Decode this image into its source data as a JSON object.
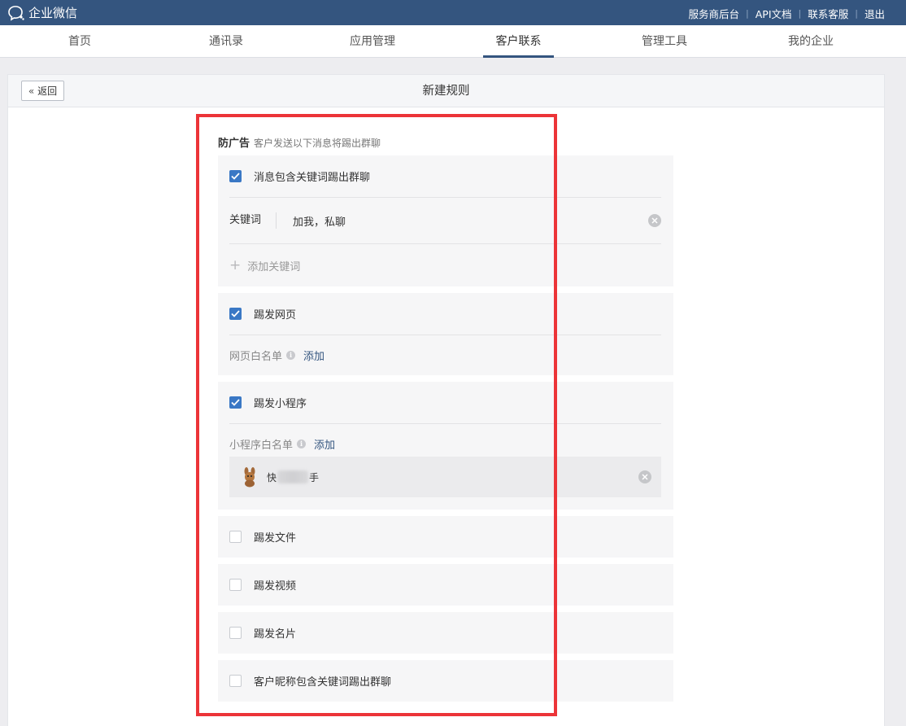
{
  "app": {
    "name": "企业微信"
  },
  "toplinks": [
    "服务商后台",
    "API文档",
    "联系客服",
    "退出"
  ],
  "nav": [
    "首页",
    "通讯录",
    "应用管理",
    "客户联系",
    "管理工具",
    "我的企业"
  ],
  "page": {
    "back_label": "返回",
    "title": "新建规则"
  },
  "section": {
    "title": "防广告",
    "subtitle": "客户发送以下消息将踢出群聊"
  },
  "keyword_block": {
    "checkbox_label": "消息包含关键词踢出群聊",
    "checked": true,
    "keyword_label": "关键词",
    "keyword_value": "加我，私聊",
    "add_keyword_label": "添加关键词"
  },
  "webpage_block": {
    "checkbox_label": "踢发网页",
    "checked": true,
    "whitelist_label": "网页白名单",
    "add_label": "添加"
  },
  "miniprogram_block": {
    "checkbox_label": "踢发小程序",
    "checked": true,
    "whitelist_label": "小程序白名单",
    "add_label": "添加",
    "item_name_start": "快",
    "item_name_end": "手"
  },
  "other_options": [
    {
      "label": "踢发文件",
      "checked": false
    },
    {
      "label": "踢发视频",
      "checked": false
    },
    {
      "label": "踢发名片",
      "checked": false
    },
    {
      "label": "客户昵称包含关键词踢出群聊",
      "checked": false
    }
  ],
  "colors": {
    "topbar": "#34557f",
    "accent": "#3a78c5",
    "highlight_box": "#ec3438"
  }
}
